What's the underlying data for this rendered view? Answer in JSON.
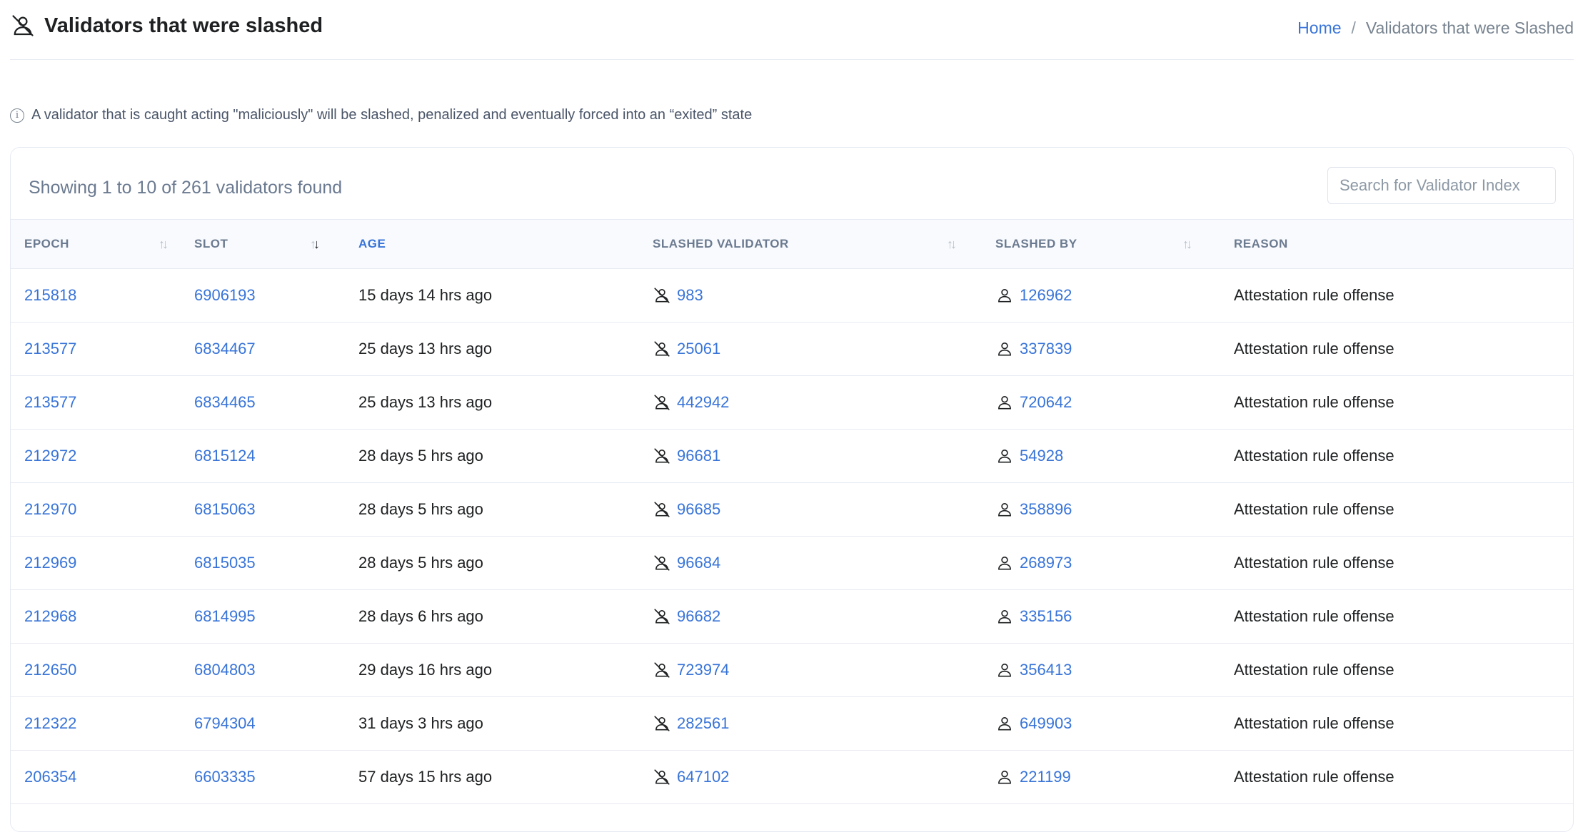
{
  "page": {
    "title": "Validators that were slashed",
    "title_icon": "slashed-user-icon"
  },
  "breadcrumb": {
    "home": "Home",
    "separator": "/",
    "current": "Validators that were Slashed"
  },
  "info": {
    "icon": "info-icon",
    "text": "A validator that is caught acting \"maliciously\" will be slashed, penalized and eventually forced into an “exited” state"
  },
  "table_card": {
    "showing": "Showing 1 to 10 of 261 validators found",
    "search_placeholder": "Search for Validator Index",
    "columns": [
      "EPOCH",
      "SLOT",
      "AGE",
      "SLASHED VALIDATOR",
      "SLASHED BY",
      "REASON"
    ],
    "rows": [
      {
        "epoch": "215818",
        "slot": "6906193",
        "age": "15 days 14 hrs ago",
        "slashed_validator": "983",
        "slashed_by": "126962",
        "reason": "Attestation rule offense"
      },
      {
        "epoch": "213577",
        "slot": "6834467",
        "age": "25 days 13 hrs ago",
        "slashed_validator": "25061",
        "slashed_by": "337839",
        "reason": "Attestation rule offense"
      },
      {
        "epoch": "213577",
        "slot": "6834465",
        "age": "25 days 13 hrs ago",
        "slashed_validator": "442942",
        "slashed_by": "720642",
        "reason": "Attestation rule offense"
      },
      {
        "epoch": "212972",
        "slot": "6815124",
        "age": "28 days 5 hrs ago",
        "slashed_validator": "96681",
        "slashed_by": "54928",
        "reason": "Attestation rule offense"
      },
      {
        "epoch": "212970",
        "slot": "6815063",
        "age": "28 days 5 hrs ago",
        "slashed_validator": "96685",
        "slashed_by": "358896",
        "reason": "Attestation rule offense"
      },
      {
        "epoch": "212969",
        "slot": "6815035",
        "age": "28 days 5 hrs ago",
        "slashed_validator": "96684",
        "slashed_by": "268973",
        "reason": "Attestation rule offense"
      },
      {
        "epoch": "212968",
        "slot": "6814995",
        "age": "28 days 6 hrs ago",
        "slashed_validator": "96682",
        "slashed_by": "335156",
        "reason": "Attestation rule offense"
      },
      {
        "epoch": "212650",
        "slot": "6804803",
        "age": "29 days 16 hrs ago",
        "slashed_validator": "723974",
        "slashed_by": "356413",
        "reason": "Attestation rule offense"
      },
      {
        "epoch": "212322",
        "slot": "6794304",
        "age": "31 days 3 hrs ago",
        "slashed_validator": "282561",
        "slashed_by": "649903",
        "reason": "Attestation rule offense"
      },
      {
        "epoch": "206354",
        "slot": "6603335",
        "age": "57 days 15 hrs ago",
        "slashed_validator": "647102",
        "slashed_by": "221199",
        "reason": "Attestation rule offense"
      }
    ]
  },
  "colors": {
    "link": "#3874d8",
    "muted": "#6b7a90",
    "border": "#e7eaf3",
    "header_bg": "#f8fafd"
  }
}
